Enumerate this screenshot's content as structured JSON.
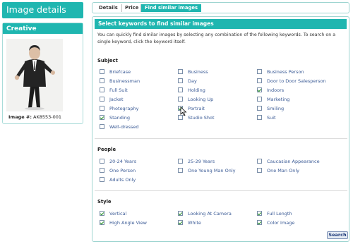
{
  "page": {
    "title": "Image details"
  },
  "left_panel": {
    "header": "Creative",
    "image_number_label": "Image #:",
    "image_number": "AK8553-001"
  },
  "tabs": [
    {
      "label": "Details",
      "active": false
    },
    {
      "label": "Price",
      "active": false
    },
    {
      "label": "Find similar images",
      "active": true
    }
  ],
  "main": {
    "header": "Select keywords to find similar images",
    "intro": "You can quickly find similar images by selecting any combination of the following keywords. To search on a single keyword, click the keyword itself."
  },
  "sections": [
    {
      "title": "Subject",
      "keywords": [
        {
          "label": "Briefcase",
          "checked": false
        },
        {
          "label": "Business",
          "checked": false
        },
        {
          "label": "Business Person",
          "checked": false
        },
        {
          "label": "Businessman",
          "checked": false
        },
        {
          "label": "Day",
          "checked": false
        },
        {
          "label": "Door to Door Salesperson",
          "checked": false
        },
        {
          "label": "Full Suit",
          "checked": false
        },
        {
          "label": "Holding",
          "checked": false
        },
        {
          "label": "Indoors",
          "checked": true
        },
        {
          "label": "Jacket",
          "checked": false
        },
        {
          "label": "Looking Up",
          "checked": false
        },
        {
          "label": "Marketing",
          "checked": false
        },
        {
          "label": "Photography",
          "checked": false
        },
        {
          "label": "Portrait",
          "checked": true
        },
        {
          "label": "Smiling",
          "checked": false
        },
        {
          "label": "Standing",
          "checked": true
        },
        {
          "label": "Studio Shot",
          "checked": false
        },
        {
          "label": "Suit",
          "checked": false
        },
        {
          "label": "Well-dressed",
          "checked": false
        }
      ]
    },
    {
      "title": "People",
      "keywords": [
        {
          "label": "20-24 Years",
          "checked": false
        },
        {
          "label": "25-29 Years",
          "checked": false
        },
        {
          "label": "Caucasian Appearance",
          "checked": false
        },
        {
          "label": "One Person",
          "checked": false
        },
        {
          "label": "One Young Man Only",
          "checked": false
        },
        {
          "label": "One Man Only",
          "checked": false
        },
        {
          "label": "Adults Only",
          "checked": false
        }
      ]
    },
    {
      "title": "Style",
      "keywords": [
        {
          "label": "Vertical",
          "checked": true
        },
        {
          "label": "Looking At Camera",
          "checked": true
        },
        {
          "label": "Full Length",
          "checked": true
        },
        {
          "label": "High Angle View",
          "checked": true
        },
        {
          "label": "White",
          "checked": true
        },
        {
          "label": "Color Image",
          "checked": true
        }
      ]
    }
  ],
  "search_button": {
    "label": "Search"
  },
  "colors": {
    "accent": "#1fb6b0",
    "link": "#3a5a95",
    "check": "#1d8c1d"
  }
}
